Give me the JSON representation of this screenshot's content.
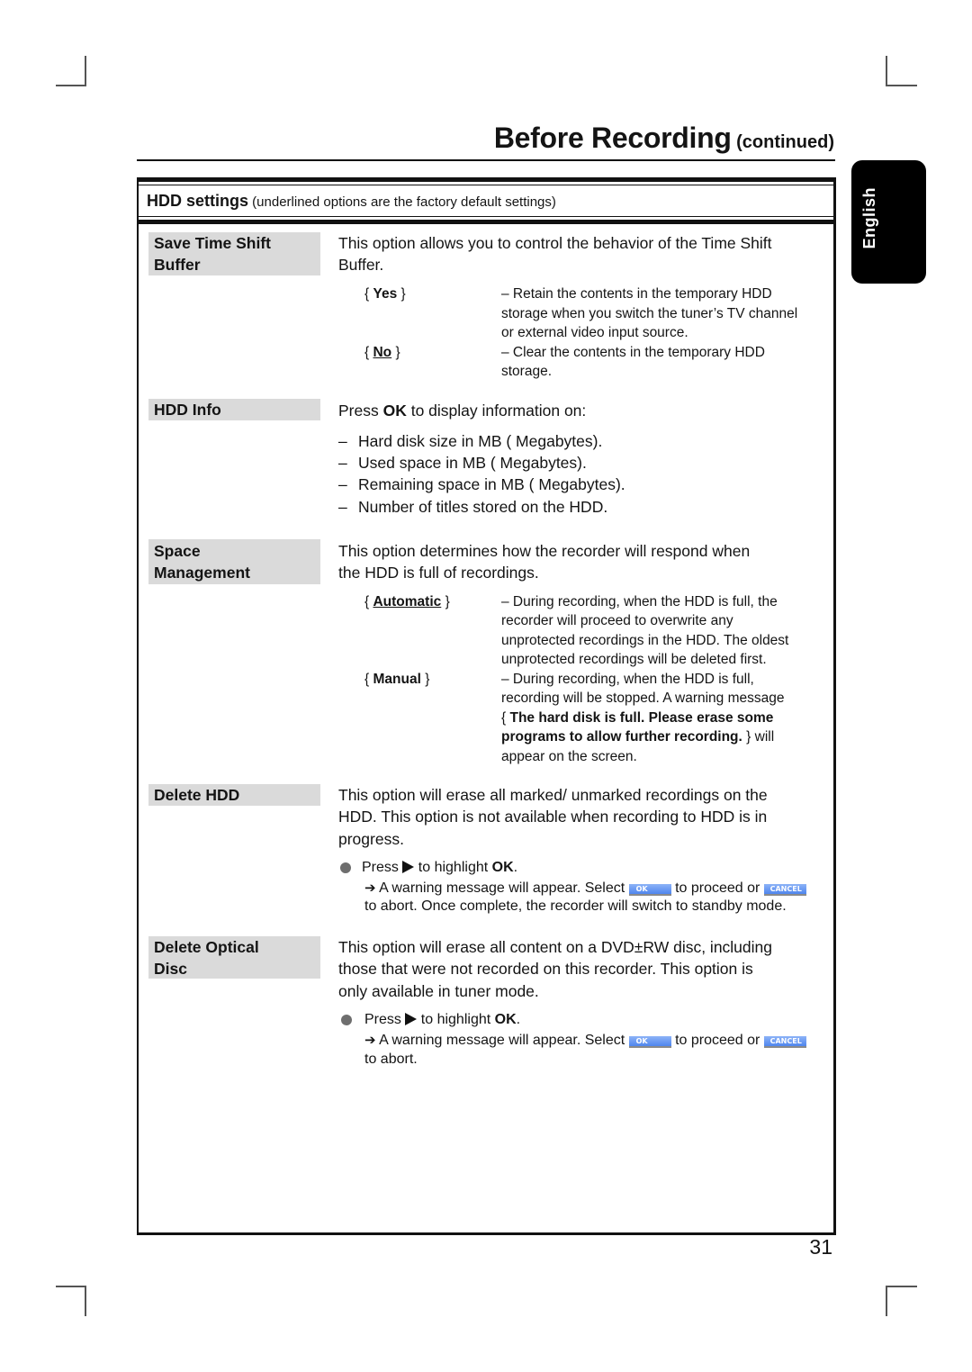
{
  "page": {
    "title": "Before Recording",
    "title_suffix": " (continued)",
    "language_tab": "English",
    "page_number": "31"
  },
  "settings_header": {
    "title": "HDD settings",
    "note": " (underlined options are the factory default settings)"
  },
  "symbols": {
    "brace_open": "{ ",
    "brace_close": " }",
    "list_dash": "–"
  },
  "buttons": {
    "ok": "OK",
    "cancel": "CANCEL",
    "color": "#4f86ee"
  },
  "colors": {
    "label_background": "#dadada",
    "language_tab_background": "#000000",
    "text": "#141414"
  },
  "icons": {
    "step_bullet": "filled-circle",
    "play_key": "play-triangle",
    "result_arrow": "right-arrow"
  },
  "sections": [
    {
      "label_lines": [
        "Save Time Shift",
        "Buffer"
      ],
      "description_lines": [
        "This option allows you to control the behavior of the Time Shift",
        "Buffer."
      ],
      "options": [
        {
          "key": "Yes",
          "is_default": false,
          "desc_lines": [
            "– Retain the contents in the temporary HDD",
            "storage when you switch the tuner’s TV channel",
            "or external video input source."
          ]
        },
        {
          "key": "No",
          "is_default": true,
          "desc_lines": [
            "– Clear the contents in the temporary HDD",
            "storage."
          ]
        }
      ]
    },
    {
      "label_lines": [
        "HDD Info"
      ],
      "intro": {
        "pre": "Press ",
        "bold": "OK",
        "post": " to display information on:"
      },
      "list_items": [
        "Hard disk size in MB ( Megabytes).",
        "Used space in MB ( Megabytes).",
        "Remaining space in MB ( Megabytes).",
        "Number of titles stored on the HDD."
      ]
    },
    {
      "label_lines": [
        "Space",
        "Management"
      ],
      "description_lines": [
        "This option determines how the recorder will respond when",
        "the HDD is full of recordings."
      ],
      "options": [
        {
          "key": "Automatic",
          "is_default": true,
          "desc_lines": [
            "– During recording, when the HDD is full, the",
            "recorder will proceed to overwrite any",
            "unprotected recordings in the HDD. The oldest",
            "unprotected recordings will be deleted first."
          ]
        },
        {
          "key": "Manual",
          "is_default": false,
          "desc_lines": [
            "– During recording, when the HDD is full,",
            "recording will be stopped. A warning message",
            {
              "pre": "{ ",
              "bold": "The hard disk is full. Please erase some",
              "post": ""
            },
            {
              "pre": "",
              "bold": "programs to allow further recording.",
              "post": " } will"
            },
            "appear on the screen."
          ]
        }
      ]
    },
    {
      "label_lines": [
        "Delete HDD"
      ],
      "description_lines": [
        "This option will erase all marked/ unmarked recordings on the",
        "HDD. This option is not available when recording to HDD is in",
        "progress."
      ],
      "step": {
        "press": "Press ",
        "middle": " to highlight ",
        "bold": "OK",
        "end": "."
      },
      "result": {
        "text1": " A warning message will appear. Select ",
        "text2": " to proceed or ",
        "continuation": "to abort. Once complete, the recorder will switch to standby mode."
      }
    },
    {
      "label_lines": [
        "Delete Optical",
        "Disc"
      ],
      "description_lines": [
        "This option will erase all content on a DVD±RW disc, including",
        "those that were not recorded on this recorder. This option is",
        "only available in tuner mode."
      ],
      "step": {
        "press": "Press ",
        "middle": " to highlight ",
        "bold": "OK",
        "end": "."
      },
      "result": {
        "text1": " A warning message will appear. Select ",
        "text2": " to proceed or ",
        "continuation": "to abort."
      }
    }
  ]
}
